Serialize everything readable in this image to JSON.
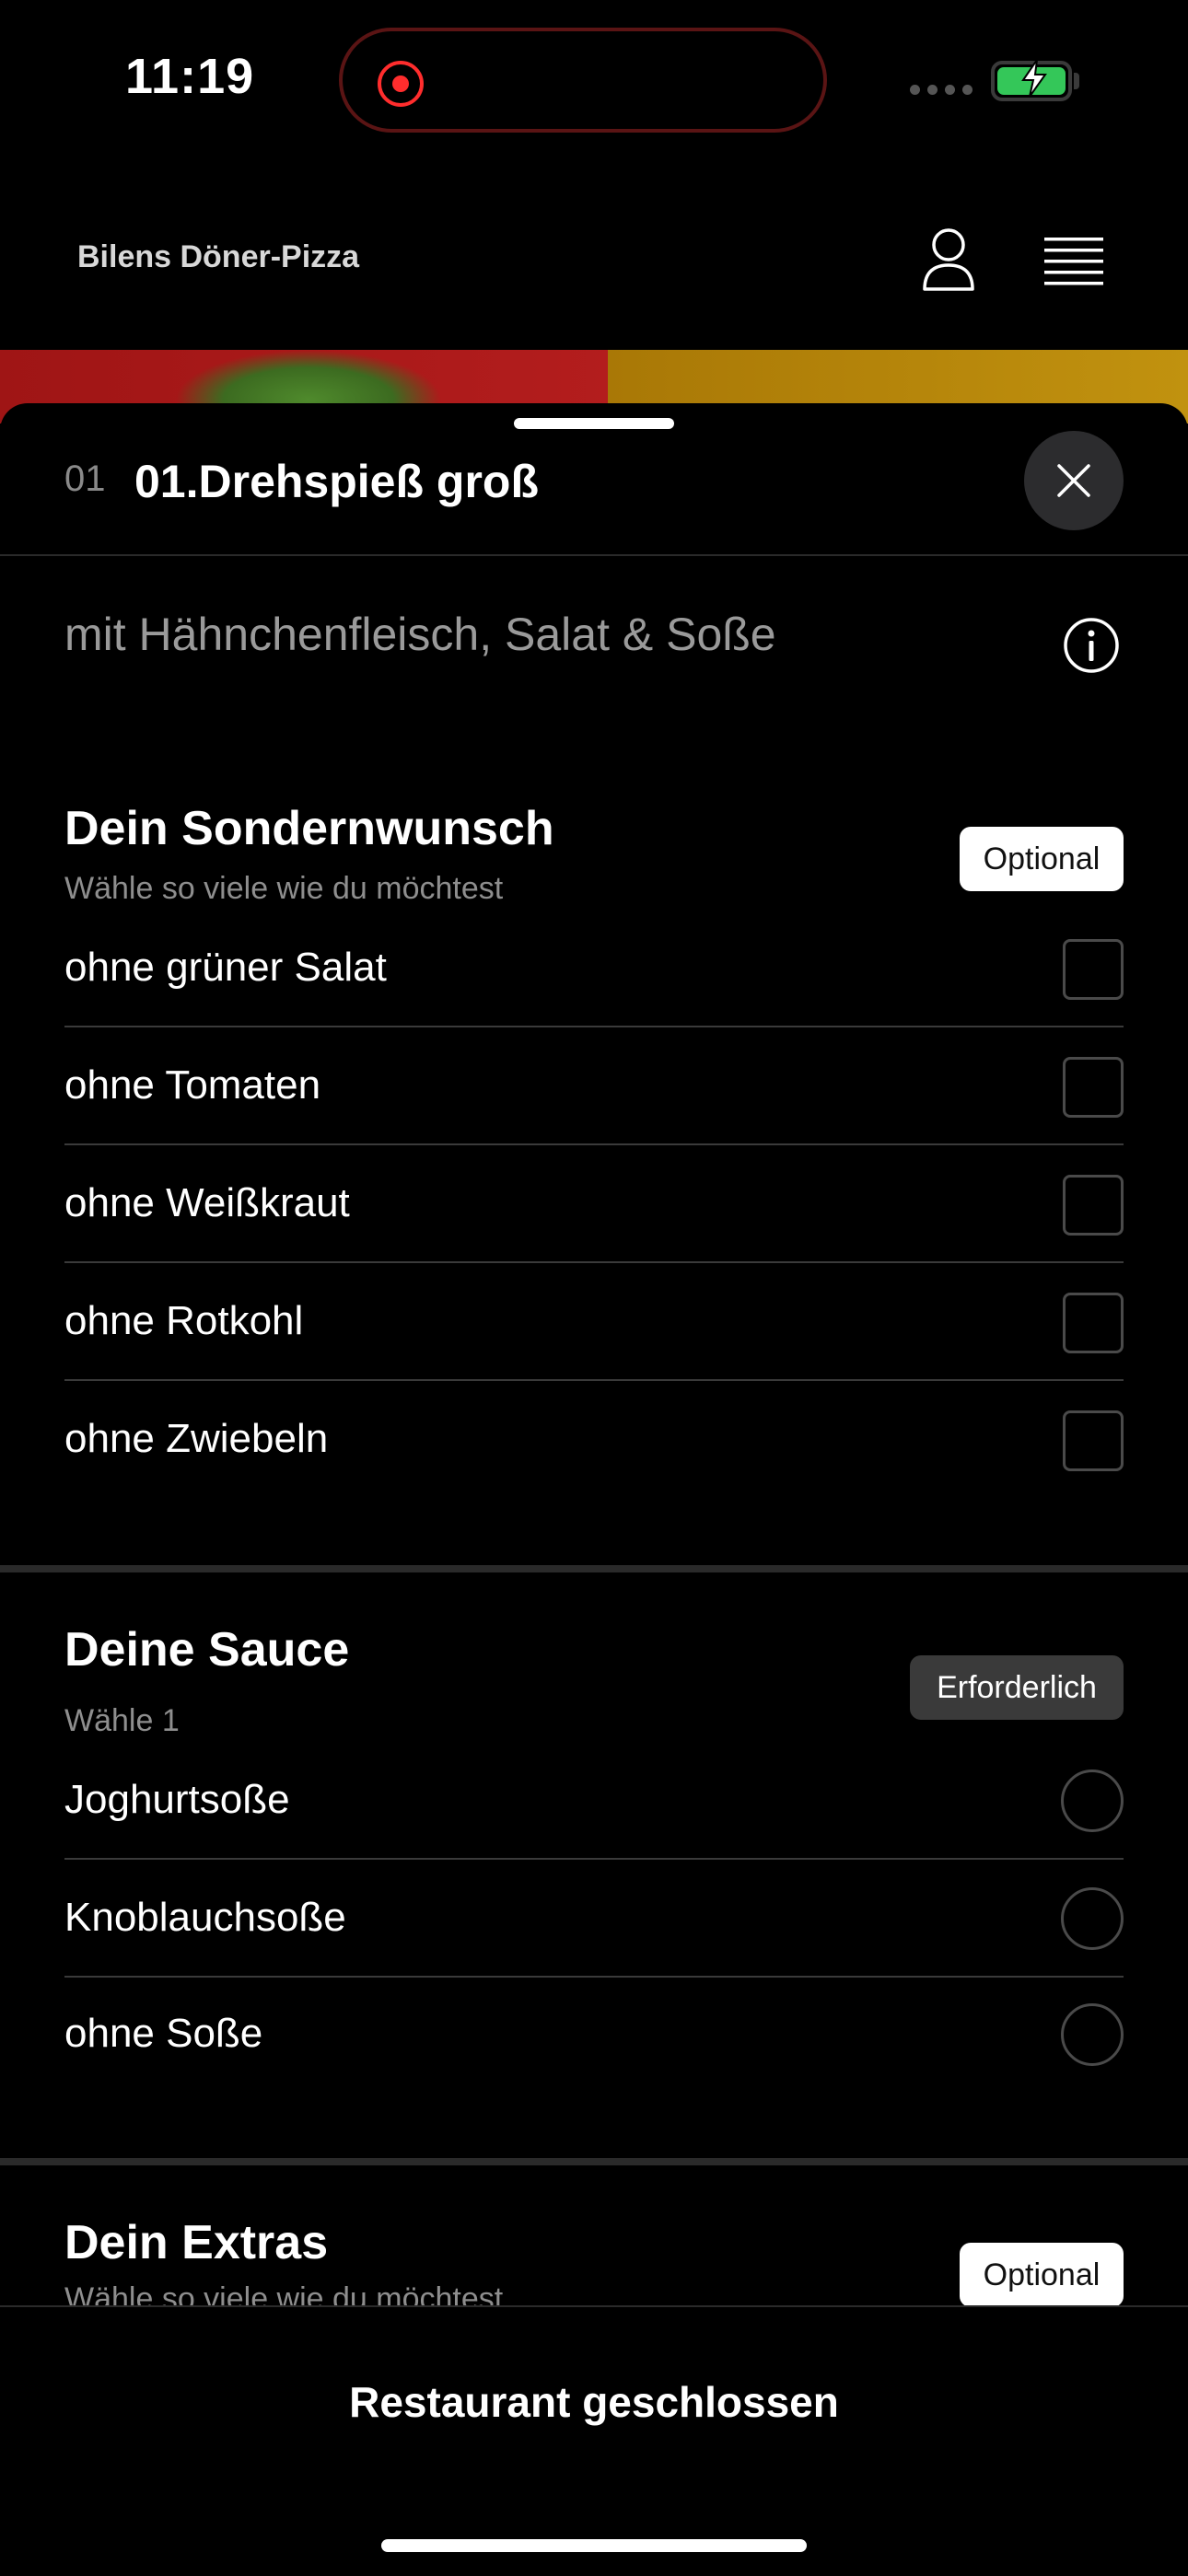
{
  "status_bar": {
    "time": "11:19"
  },
  "header": {
    "title": "Bilens Döner-Pizza"
  },
  "product": {
    "number": "01",
    "title": "01.Drehspieß groß",
    "description": "mit Hähnchenfleisch, Salat & Soße"
  },
  "sections": {
    "sondernwunsch": {
      "title": "Dein Sondernwunsch",
      "subtitle": "Wähle so viele wie du möchtest",
      "badge": "Optional",
      "options": [
        "ohne grüner Salat",
        "ohne Tomaten",
        "ohne Weißkraut",
        "ohne Rotkohl",
        "ohne Zwiebeln"
      ]
    },
    "sauce": {
      "title": "Deine Sauce",
      "subtitle": "Wähle 1",
      "badge": "Erforderlich",
      "options": [
        "Joghurtsoße",
        "Knoblauchsoße",
        "ohne Soße"
      ]
    },
    "extras": {
      "title": "Dein Extras",
      "subtitle": "Wähle so viele wie du möchtest",
      "badge": "Optional"
    }
  },
  "footer": {
    "button_label": "Restaurant geschlossen"
  },
  "colors": {
    "accent_green": "#34c759",
    "record_red": "#ff2d2d"
  }
}
